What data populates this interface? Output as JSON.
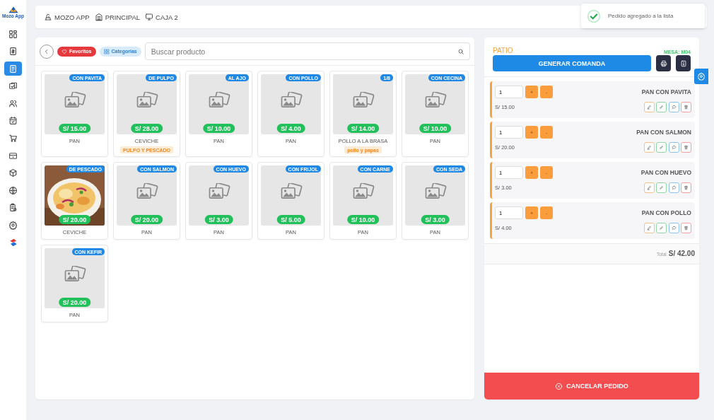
{
  "sidebar": {
    "logo_text": "Mozo App",
    "items": [
      {
        "selected": false
      },
      {
        "selected": false
      },
      {
        "selected": true
      },
      {
        "selected": false
      },
      {
        "selected": false
      },
      {
        "selected": false
      },
      {
        "selected": false
      },
      {
        "selected": false
      },
      {
        "selected": false
      },
      {
        "selected": false
      },
      {
        "selected": false
      },
      {
        "selected": false
      },
      {
        "selected": false
      }
    ]
  },
  "breadcrumb": [
    {
      "label": "MOZO APP"
    },
    {
      "label": "PRINCIPAL"
    },
    {
      "label": "CAJA 2"
    }
  ],
  "toast": {
    "message": "Pedido agregado a la lista"
  },
  "catalog": {
    "filters": [
      {
        "kind": "favorites",
        "label": "Favoritos"
      },
      {
        "kind": "categories",
        "label": "Categorias"
      }
    ],
    "search": {
      "placeholder": "Buscar producto"
    },
    "products": [
      {
        "badge": "CON PAVITA",
        "price": "S/ 15.00",
        "name": "PAN"
      },
      {
        "badge": "DE PULPO",
        "price": "S/ 28.00",
        "name": "CEVICHE",
        "tag": "PULPO Y PESCADO"
      },
      {
        "badge": "AL AJO",
        "price": "S/ 10.00",
        "name": "PAN"
      },
      {
        "badge": "CON POLLO",
        "price": "S/ 4.00",
        "name": "PAN"
      },
      {
        "badge": "1/8",
        "price": "S/ 14.00",
        "name": "POLLO A LA BRASA",
        "tag": "pollo y papas"
      },
      {
        "badge": "CON CECINA",
        "price": "S/ 10.00",
        "name": "PAN"
      },
      {
        "badge": "DE PESCADO",
        "price": "S/ 20.00",
        "name": "CEVICHE",
        "kind": "picture"
      },
      {
        "badge": "CON SALMON",
        "price": "S/ 20.00",
        "name": "PAN"
      },
      {
        "badge": "CON HUEVO",
        "price": "S/ 3.00",
        "name": "PAN"
      },
      {
        "badge": "CON FRIJOL",
        "price": "S/ 5.00",
        "name": "PAN"
      },
      {
        "badge": "CON CARNE",
        "price": "S/ 10.00",
        "name": "PAN"
      },
      {
        "badge": "CON SEDA",
        "price": "S/ 3.00",
        "name": "PAN"
      },
      {
        "badge": "CON KEFIR",
        "price": "S/ 20.00",
        "name": "PAN"
      }
    ]
  },
  "order": {
    "area": "PATIO",
    "table": "MESA: M04",
    "generate_button": "GENERAR COMANDA",
    "items": [
      {
        "quantity": "1",
        "increase": "+",
        "decrease": "-",
        "name": "PAN CON PAVITA",
        "price": "S/ 15.00"
      },
      {
        "quantity": "1",
        "increase": "+",
        "decrease": "-",
        "name": "PAN CON SALMON",
        "price": "S/ 20.00"
      },
      {
        "quantity": "1",
        "increase": "+",
        "decrease": "-",
        "name": "PAN CON HUEVO",
        "price": "S/ 3.00"
      },
      {
        "quantity": "1",
        "increase": "+",
        "decrease": "-",
        "name": "PAN CON POLLO",
        "price": "S/ 4.00"
      }
    ],
    "total_label": "Total",
    "total": "S/ 42.00",
    "cancel_button": "CANCELAR PEDIDO"
  }
}
